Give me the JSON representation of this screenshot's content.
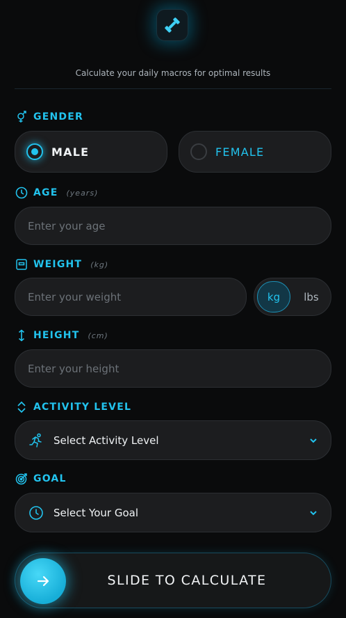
{
  "subtitle": "Calculate your daily macros for optimal results",
  "colors": {
    "accent": "#22c3ee",
    "background": "#0a0b0c",
    "field": "#1c1d1f"
  },
  "gender": {
    "label": "GENDER",
    "icon": "gender-icon",
    "options": [
      {
        "label": "MALE",
        "selected": true
      },
      {
        "label": "FEMALE",
        "selected": false
      }
    ]
  },
  "age": {
    "label": "AGE",
    "unit": "(years)",
    "placeholder": "Enter your age",
    "icon": "clock-icon"
  },
  "weight": {
    "label": "WEIGHT",
    "unit": "(kg)",
    "placeholder": "Enter your weight",
    "icon": "scale-icon",
    "units": [
      "kg",
      "lbs"
    ],
    "selected_unit": "kg"
  },
  "height": {
    "label": "HEIGHT",
    "unit": "(cm)",
    "placeholder": "Enter your height",
    "icon": "vertical-arrows-icon"
  },
  "activity": {
    "label": "ACTIVITY LEVEL",
    "value": "Select Activity Level",
    "icon": "up-down-chevron-icon",
    "select_icon": "runner-icon"
  },
  "goal": {
    "label": "GOAL",
    "value": "Select Your Goal",
    "icon": "target-icon",
    "select_icon": "clock-icon"
  },
  "submit": {
    "label": "SLIDE TO CALCULATE",
    "icon": "arrow-right-icon"
  }
}
